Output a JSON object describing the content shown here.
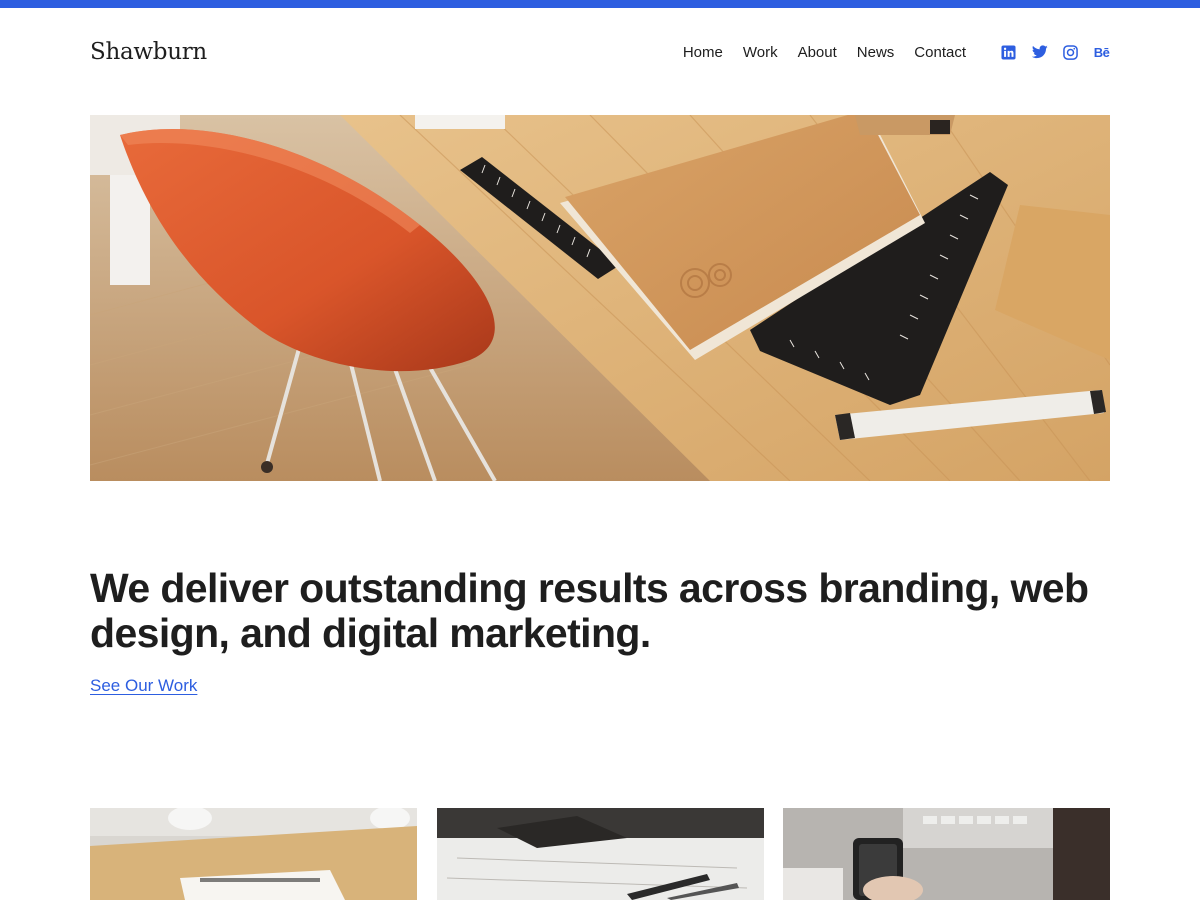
{
  "site": {
    "title": "Shawburn"
  },
  "nav": {
    "items": [
      {
        "label": "Home"
      },
      {
        "label": "Work"
      },
      {
        "label": "About"
      },
      {
        "label": "News"
      },
      {
        "label": "Contact"
      }
    ]
  },
  "social": {
    "icons": [
      "linkedin-icon",
      "twitter-icon",
      "instagram-icon",
      "behance-icon"
    ],
    "behance_glyph": "Bē",
    "accent_color": "#2d5ee0"
  },
  "hero": {
    "image": "desk-with-orange-chair-notebook-rulers-marker"
  },
  "content": {
    "headline": "We deliver outstanding results across branding, web design, and digital marketing.",
    "cta_label": "See Our Work"
  },
  "portfolio": {
    "cards": [
      {
        "image": "desk-with-stack-of-papers"
      },
      {
        "image": "sketches-with-pen"
      },
      {
        "image": "hand-holding-phone-near-keyboard"
      }
    ]
  },
  "colors": {
    "top_bar": "#2d5ee0",
    "text": "#1e1e1e",
    "link": "#2d5ee0"
  }
}
